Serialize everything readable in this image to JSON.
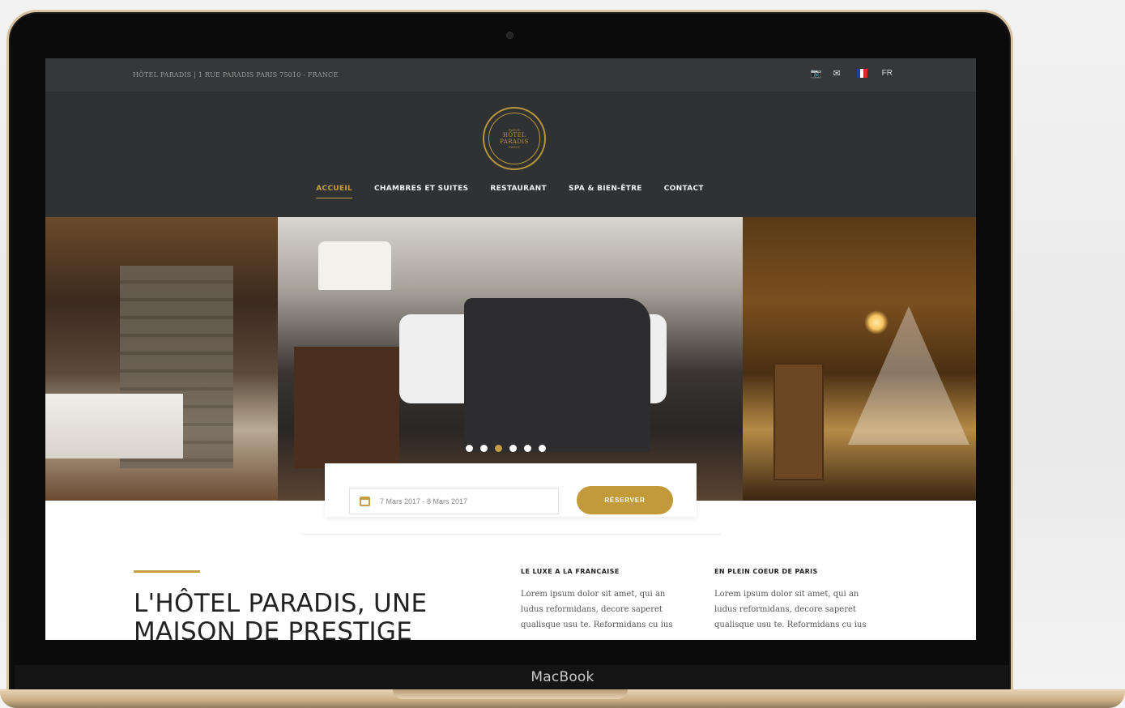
{
  "device": {
    "brand": "MacBook"
  },
  "topbar": {
    "address": "HÔTEL PARADIS | 1 RUE PARADIS PARIS 75010 - FRANCE",
    "language": "FR"
  },
  "logo": {
    "top": "PARIS",
    "name_line1": "HÔTEL",
    "name_line2": "PARADIS",
    "bottom": "PARIS"
  },
  "nav": {
    "items": [
      {
        "label": "ACCUEIL",
        "active": true
      },
      {
        "label": "CHAMBRES ET SUITES"
      },
      {
        "label": "RESTAURANT"
      },
      {
        "label": "SPA & BIEN-ÊTRE"
      },
      {
        "label": "CONTACT"
      }
    ]
  },
  "slider": {
    "dot_count": 6,
    "active_index": 2
  },
  "booking": {
    "dates": "7 Mars 2017 - 8 Mars 2017",
    "button": "RÉSERVER"
  },
  "intro": {
    "title_line1": "L'HÔTEL PARADIS, UNE",
    "title_line2": "MAISON DE PRESTIGE"
  },
  "columns": [
    {
      "title": "LE LUXE A LA FRANCAISE",
      "text": "Lorem ipsum dolor sit amet, qui an ludus reformidans, decore saperet qualisque usu te. Reformidans cu ius"
    },
    {
      "title": "EN PLEIN COEUR DE PARIS",
      "text": "Lorem ipsum dolor sit amet, qui an ludus reformidans, decore saperet qualisque usu te. Reformidans cu ius"
    }
  ],
  "colors": {
    "accent": "#c59f41",
    "dark": "#303132",
    "topbar": "#363738"
  },
  "icons": [
    "camera-icon",
    "mail-icon",
    "flag-fr-icon",
    "calendar-icon"
  ]
}
